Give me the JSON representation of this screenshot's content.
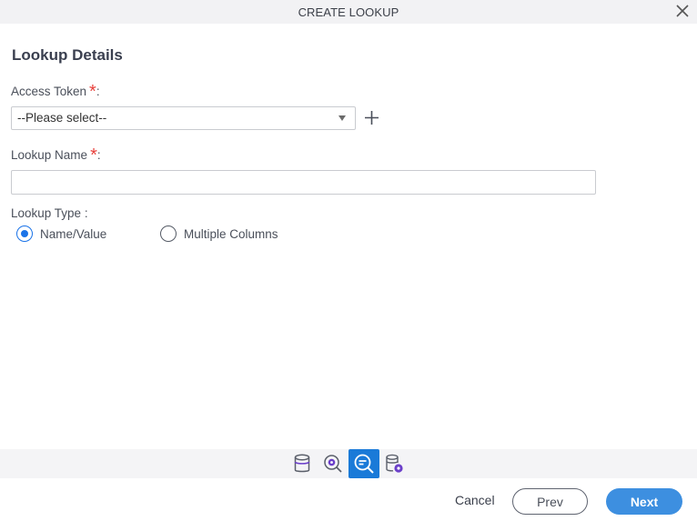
{
  "dialog": {
    "title": "CREATE LOOKUP",
    "close_icon": "close-icon"
  },
  "form": {
    "section_title": "Lookup Details",
    "access_token": {
      "label": "Access Token",
      "required_mark": "*",
      "suffix": ":",
      "selected_value": "--Please select--",
      "add_icon": "plus-icon"
    },
    "lookup_name": {
      "label": "Lookup Name",
      "required_mark": "*",
      "suffix": ":",
      "value": "",
      "placeholder": ""
    },
    "lookup_type": {
      "label": "Lookup Type :",
      "options": [
        {
          "label": "Name/Value",
          "checked": true
        },
        {
          "label": "Multiple Columns",
          "checked": false
        }
      ]
    }
  },
  "steps": [
    {
      "icon": "database-icon",
      "active": false
    },
    {
      "icon": "search-settings-icon",
      "active": false
    },
    {
      "icon": "search-details-icon",
      "active": true
    },
    {
      "icon": "database-settings-icon",
      "active": false
    }
  ],
  "footer": {
    "cancel_label": "Cancel",
    "prev_label": "Prev",
    "next_label": "Next"
  },
  "colors": {
    "accent": "#1a7ad8",
    "next_button": "#3d8fe0",
    "required": "#e8413c",
    "step_icon_purple": "#6b3fc9"
  }
}
